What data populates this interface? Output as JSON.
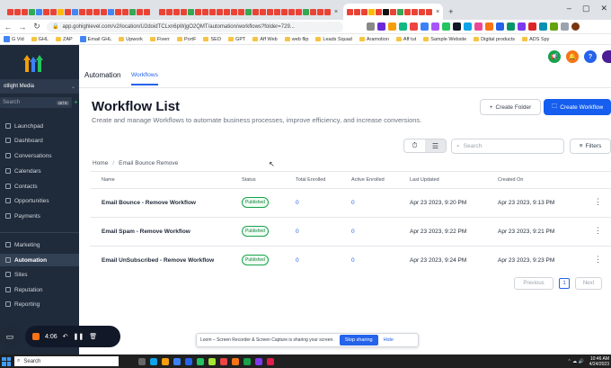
{
  "browser": {
    "tab2_close": "×",
    "tab3_close": "×",
    "new_tab": "+",
    "window_controls": [
      "–",
      "▢",
      "✕"
    ],
    "url": "app.gohighlevel.com/v2/location/U2doidTCLxn6pWjgO2QMT/automation/workflows?folder=729..."
  },
  "bookmarks": [
    {
      "label": "G Vid",
      "type": "link"
    },
    {
      "label": "GHL",
      "type": "folder"
    },
    {
      "label": "ZAP",
      "type": "folder"
    },
    {
      "label": "Email GHL",
      "type": "link"
    },
    {
      "label": "Upwork",
      "type": "folder"
    },
    {
      "label": "Fiverr",
      "type": "folder"
    },
    {
      "label": "PortF",
      "type": "folder"
    },
    {
      "label": "SEO",
      "type": "folder"
    },
    {
      "label": "GPT",
      "type": "folder"
    },
    {
      "label": "Aff Web",
      "type": "folder"
    },
    {
      "label": "web flip",
      "type": "folder"
    },
    {
      "label": "Leads Squad",
      "type": "folder"
    },
    {
      "label": "Aramotion",
      "type": "folder"
    },
    {
      "label": "Aff tut",
      "type": "folder"
    },
    {
      "label": "Sample Website",
      "type": "folder"
    },
    {
      "label": "Digital products",
      "type": "folder"
    },
    {
      "label": "ADS Spy",
      "type": "folder"
    }
  ],
  "sidebar": {
    "location_name": "otlight Media",
    "search_placeholder": "Search",
    "search_kbd": "ctrl K",
    "add": "+",
    "items": [
      {
        "label": "Launchpad",
        "active": false
      },
      {
        "label": "Dashboard",
        "active": false
      },
      {
        "label": "Conversations",
        "active": false
      },
      {
        "label": "Calendars",
        "active": false
      },
      {
        "label": "Contacts",
        "active": false
      },
      {
        "label": "Opportunities",
        "active": false
      },
      {
        "label": "Payments",
        "active": false
      },
      {
        "label": "Marketing",
        "active": false
      },
      {
        "label": "Automation",
        "active": true
      },
      {
        "label": "Sites",
        "active": false
      },
      {
        "label": "Reputation",
        "active": false
      },
      {
        "label": "Reporting",
        "active": false
      }
    ]
  },
  "topnav": {
    "title": "Automation",
    "tab": "Workflows"
  },
  "page": {
    "title": "Workflow List",
    "subtitle": "Create and manage Workflows to automate business processes, improve efficiency, and increase conversions.",
    "create_folder": "Create Folder",
    "create_workflow": "Create Workflow",
    "search_placeholder": "Search",
    "filters": "Filters",
    "breadcrumb": [
      "Home",
      "Email Bounce Remove"
    ]
  },
  "table": {
    "headers": [
      "Name",
      "Status",
      "Total Enrolled",
      "Active Enrolled",
      "Last Updated",
      "Created On"
    ],
    "rows": [
      {
        "name": "Email Bounce - Remove Workflow",
        "status": "Published",
        "total": "0",
        "active": "0",
        "updated": "Apr 23 2023, 9:20 PM",
        "created": "Apr 23 2023, 9:13 PM"
      },
      {
        "name": "Email Spam - Remove Workflow",
        "status": "Published",
        "total": "0",
        "active": "0",
        "updated": "Apr 23 2023, 9:22 PM",
        "created": "Apr 23 2023, 9:21 PM"
      },
      {
        "name": "Email UnSubscribed - Remove Workflow",
        "status": "Published",
        "total": "0",
        "active": "0",
        "updated": "Apr 23 2023, 9:24 PM",
        "created": "Apr 23 2023, 9:23 PM"
      }
    ]
  },
  "pager": {
    "previous": "Previous",
    "page": "1",
    "next": "Next"
  },
  "recorder": {
    "time": "4:06"
  },
  "share_banner": {
    "text": "Loom – Screen Recorder & Screen Capture is sharing your screen.",
    "stop": "Stop sharing",
    "hide": "Hide"
  },
  "taskbar": {
    "search_placeholder": "Search",
    "time": "10:46 AM",
    "date": "4/24/2023"
  },
  "colors": {
    "sidebar_bg": "#1f2a3a",
    "accent": "#155eef",
    "published": "#16a34a"
  }
}
